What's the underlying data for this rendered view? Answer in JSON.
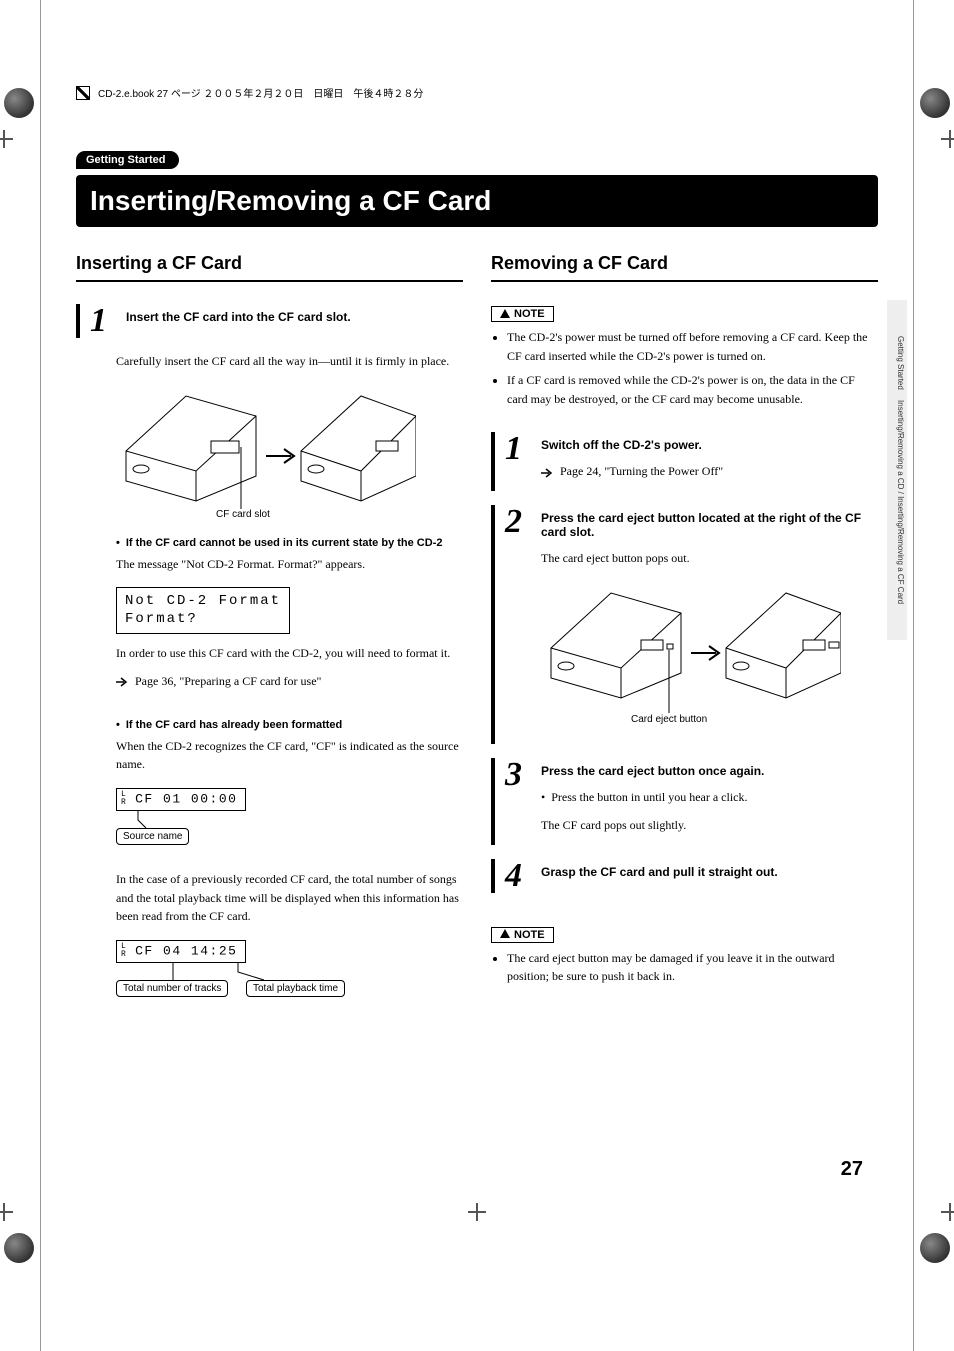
{
  "header": {
    "file_info": "CD-2.e.book  27 ページ  ２００５年２月２０日　日曜日　午後４時２８分"
  },
  "section_tag": "Getting Started",
  "page_title": "Inserting/Removing a CF Card",
  "page_number": "27",
  "side_tab": {
    "line1": "Getting Started",
    "line2": "Inserting/Removing a CD / Inserting/Removing a CF Card"
  },
  "left": {
    "heading": "Inserting a CF Card",
    "step1": {
      "num": "1",
      "title": "Insert the CF card into the CF card slot.",
      "para1": "Carefully insert the CF card all the way in—until it is firmly in place.",
      "fig_label": "CF card slot",
      "sub1_title": "If the CF card cannot be used in its current state by the CD-2",
      "sub1_para": "The message \"Not CD-2 Format. Format?\" appears.",
      "lcd1_line1": "Not CD-2 Format",
      "lcd1_line2": "Format?",
      "sub1_para2": "In order to use this CF card with the CD-2, you will need to format it.",
      "ref1": "Page 36, \"Preparing a CF card for use\"",
      "sub2_title": "If the CF card has already been formatted",
      "sub2_para": "When the CD-2 recognizes the CF card, \"CF\" is indicated as the source name.",
      "lcd2_text": "CF   01   00:00",
      "lcd2_lr": "L\nR",
      "callout_source": "Source name",
      "sub2_para2": "In the case of a previously recorded CF card, the total number of songs and the total playback time will be displayed when this information has been read from the CF card.",
      "lcd3_text": "CF   04   14:25",
      "callout_tracks": "Total number of tracks",
      "callout_time": "Total playback time"
    }
  },
  "right": {
    "heading": "Removing a CF Card",
    "note1_label": "NOTE",
    "note1_items": [
      "The CD-2's power must be turned off before removing a CF card. Keep the CF card inserted while the CD-2's power is turned on.",
      "If a CF card is removed while the CD-2's power is on, the data in the CF card may be destroyed, or the CF card may become unusable."
    ],
    "step1": {
      "num": "1",
      "title": "Switch off the CD-2's power.",
      "ref": "Page 24, \"Turning the Power Off\""
    },
    "step2": {
      "num": "2",
      "title": "Press the card eject button located at the right of the CF card slot.",
      "para": "The card eject button pops out.",
      "fig_label": "Card eject button"
    },
    "step3": {
      "num": "3",
      "title": "Press the card eject button once again.",
      "bullet": "Press the button in until you hear a click.",
      "para": "The CF card pops out slightly."
    },
    "step4": {
      "num": "4",
      "title": "Grasp the CF card and pull it straight out."
    },
    "note2_label": "NOTE",
    "note2_items": [
      "The card eject button may be damaged if you leave it in the outward position; be sure to push it back in."
    ]
  }
}
